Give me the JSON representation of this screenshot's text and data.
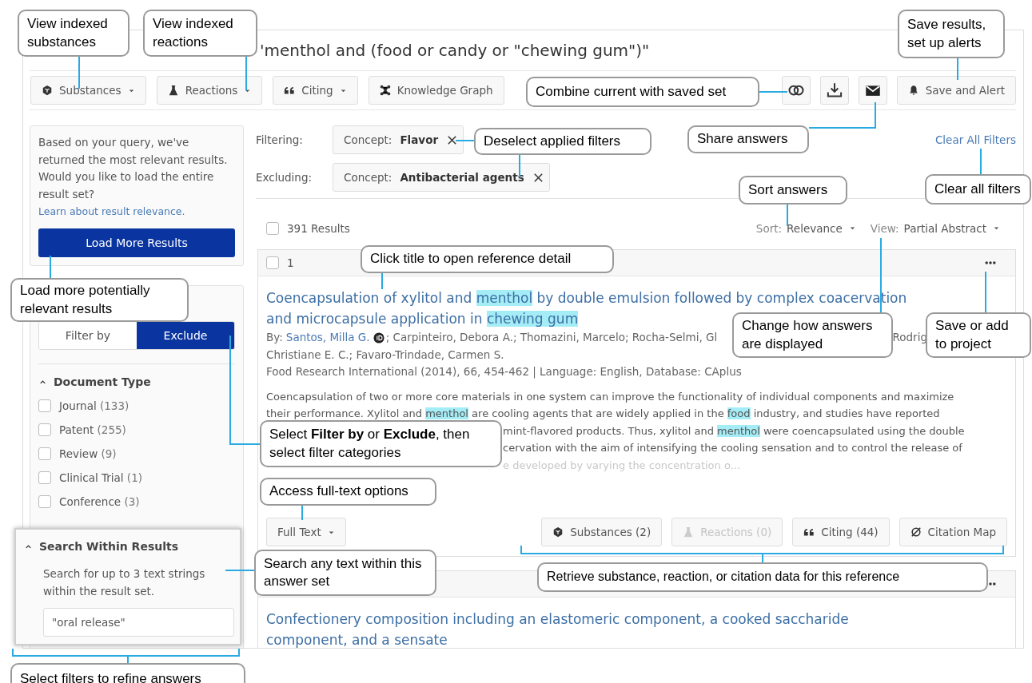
{
  "query_title": "'menthol and (food or candy or \"chewing gum\")\"",
  "toolbar": {
    "left": [
      {
        "label": "Substances",
        "dropdown": true
      },
      {
        "label": "Reactions",
        "dropdown": true
      },
      {
        "label": "Citing",
        "dropdown": true
      },
      {
        "label": "Knowledge Graph",
        "dropdown": false
      }
    ],
    "save_button": "Save and Alert"
  },
  "relevance_notice": {
    "text": "Based on your query, we've returned the most relevant results. Would you like to load the entire result set?",
    "link": "Learn about result relevance.",
    "button": "Load More Results"
  },
  "filter_panel": {
    "tabs": [
      {
        "label": "Filter by",
        "selected": false
      },
      {
        "label": "Exclude",
        "selected": true
      }
    ],
    "sections": [
      {
        "title": "Document Type",
        "expanded": true,
        "options": [
          {
            "label": "Journal",
            "count": "(133)",
            "checked": false
          },
          {
            "label": "Patent",
            "count": "(255)",
            "checked": false
          },
          {
            "label": "Review",
            "count": "(9)",
            "checked": false
          },
          {
            "label": "Clinical Trial",
            "count": "(1)",
            "checked": false
          },
          {
            "label": "Conference",
            "count": "(3)",
            "checked": false
          }
        ]
      }
    ]
  },
  "search_within": {
    "title": "Search Within Results",
    "expanded": true,
    "hint": "Search for up to 3 text strings within the result set.",
    "value": "\"oral release\""
  },
  "applied_filters": [
    {
      "label": "Filtering:",
      "chip": "Concept: **Flavor**"
    },
    {
      "label": "Excluding:",
      "chip": "Concept: **Antibacterial agents**"
    }
  ],
  "clear_filters": "Clear All Filters",
  "results_bar": {
    "count": "391 Results",
    "checked": false,
    "sort_label": "Sort:",
    "sort_value": "Relevance",
    "view_label": "View:",
    "view_value": "Partial Abstract"
  },
  "results": [
    {
      "number": "1",
      "checked": false,
      "title": [
        {
          "text": "Coencapsulation of xylitol and ",
          "highlight": false
        },
        {
          "text": "menthol",
          "highlight": true
        },
        {
          "text": " by double emulsion followed by complex coacervation and microcapsule application in ",
          "highlight": false
        },
        {
          "text": "chewing gum",
          "highlight": true
        }
      ],
      "authors_prefix": "By:",
      "first_author": "Santos, Milla G.",
      "authors_rest": "; Carpinteiro, Debora A.; Thomazini, Marcelo; Rocha-Selmi, Gl",
      "authors_tail": "Rodrig",
      "authors_line2": "Christiane E. C.; Favaro-Trindade, Carmen S.",
      "source": "Food Research International (2014), 66, 454-462 | Language: English, Database: CAplus",
      "abstract": [
        {
          "kind": "full",
          "faded": false,
          "segments": [
            {
              "text": "Coencapsulation of two or more core materials in one system can improve the functionality of individual components and maximize",
              "highlight": false
            }
          ]
        },
        {
          "kind": "full",
          "faded": false,
          "segments": [
            {
              "text": "their performance. Xylitol and ",
              "highlight": false
            },
            {
              "text": "menthol",
              "highlight": true
            },
            {
              "text": " are cooling agents that are widely applied in the ",
              "highlight": false
            },
            {
              "text": "food",
              "highlight": true
            },
            {
              "text": " industry, and studies have reported",
              "highlight": false
            }
          ]
        },
        {
          "kind": "clipped",
          "faded": false,
          "segments": [
            {
              "text": "mint-flavored products. Thus, xylitol and ",
              "highlight": false
            },
            {
              "text": "menthol",
              "highlight": true
            },
            {
              "text": " were coencapsulated using the double",
              "highlight": false
            }
          ]
        },
        {
          "kind": "clipped",
          "faded": false,
          "segments": [
            {
              "text": "cervation with the aim of intensifying the cooling sensation and to control the release of",
              "highlight": false
            }
          ]
        },
        {
          "kind": "clipped",
          "faded": true,
          "segments": [
            {
              "text": "e developed by varying the concentration o...",
              "highlight": false
            }
          ]
        }
      ],
      "full_text": "Full Text",
      "actions": [
        {
          "label": "Substances (2)",
          "disabled": false
        },
        {
          "label": "Reactions (0)",
          "disabled": true
        },
        {
          "label": "Citing (44)",
          "disabled": false
        },
        {
          "label": "Citation Map",
          "disabled": false
        }
      ]
    },
    {
      "title": [
        {
          "text": "Confectionery composition including an elastomeric component, a cooked saccharide component, and a sensate",
          "highlight": false
        }
      ]
    }
  ],
  "callouts": [
    {
      "text": "View indexed substances"
    },
    {
      "text": "View indexed reactions"
    },
    {
      "text": "Save results, set up alerts"
    },
    {
      "text": "Combine current with saved set"
    },
    {
      "text": "Share answers"
    },
    {
      "text": "Deselect applied filters"
    },
    {
      "text": "Clear all filters"
    },
    {
      "text": "Sort answers"
    },
    {
      "text": "Click title to open reference detail"
    },
    {
      "text": "Change how answers are displayed"
    },
    {
      "text": "Save or add to project"
    },
    {
      "text": "Load more potentially relevant results"
    },
    {
      "text": "Select **Filter by** or **Exclude**, then select filter categories"
    },
    {
      "text": "Access full-text options"
    },
    {
      "text": "Search any text within this answer set"
    },
    {
      "text": "Retrieve substance, reaction, or citation data for this reference"
    },
    {
      "text": "Select filters to refine answers"
    }
  ]
}
